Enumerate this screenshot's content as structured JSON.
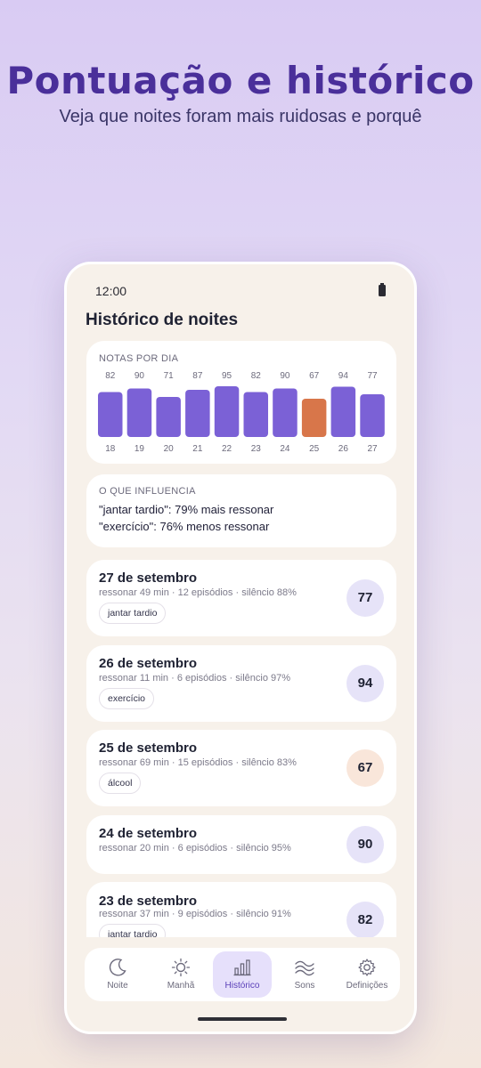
{
  "hero": {
    "title": "Pontuação e histórico",
    "subtitle": "Veja que noites foram mais ruidosas e porquê"
  },
  "status_bar": {
    "time": "12:00",
    "battery_icon": "battery-icon"
  },
  "screen": {
    "title": "Histórico de noites"
  },
  "chart_card": {
    "caption": "NOTAS POR DIA"
  },
  "chart_data": {
    "type": "bar",
    "categories": [
      "18",
      "19",
      "20",
      "21",
      "22",
      "23",
      "24",
      "25",
      "26",
      "27"
    ],
    "values": [
      82,
      90,
      71,
      87,
      95,
      82,
      90,
      67,
      94,
      77
    ],
    "highlight_index": 7,
    "colors": {
      "normal": "#7b61d6",
      "highlight": "#d8764a"
    },
    "title": "NOTAS POR DIA",
    "xlabel": "",
    "ylabel": "",
    "grid": false
  },
  "influence": {
    "caption": "O QUE INFLUENCIA",
    "lines": [
      "\"jantar tardio\": 79% mais ressonar",
      "\"exercício\": 76% menos ressonar"
    ]
  },
  "nights": [
    {
      "date": "27 de setembro",
      "stats": "ressonar 49 min · 12 episódios · silêncio 88%",
      "tag": "jantar tardio",
      "score": "77",
      "status": "normal"
    },
    {
      "date": "26 de setembro",
      "stats": "ressonar 11 min · 6 episódios · silêncio 97%",
      "tag": "exercício",
      "score": "94",
      "status": "normal"
    },
    {
      "date": "25 de setembro",
      "stats": "ressonar 69 min · 15 episódios · silêncio 83%",
      "tag": "álcool",
      "score": "67",
      "status": "warn"
    },
    {
      "date": "24 de setembro",
      "stats": "ressonar 20 min · 6 episódios · silêncio 95%",
      "tag": "",
      "score": "90",
      "status": "normal"
    },
    {
      "date": "23 de setembro",
      "stats": "ressonar 37 min · 9 episódios · silêncio 91%",
      "tag": "jantar tardio",
      "score": "82",
      "status": "normal"
    }
  ],
  "nav": {
    "items": [
      {
        "label": "Noite",
        "icon": "moon-icon"
      },
      {
        "label": "Manhã",
        "icon": "sun-icon"
      },
      {
        "label": "Histórico",
        "icon": "bar-chart-icon"
      },
      {
        "label": "Sons",
        "icon": "waves-icon"
      },
      {
        "label": "Definições",
        "icon": "gear-icon"
      }
    ],
    "active_index": 2
  },
  "colors": {
    "accent": "#4a2f9a",
    "bar": "#7b61d6",
    "bar_warn": "#d8764a",
    "badge": "#e6e3f8",
    "badge_warn": "#f9e6da"
  }
}
